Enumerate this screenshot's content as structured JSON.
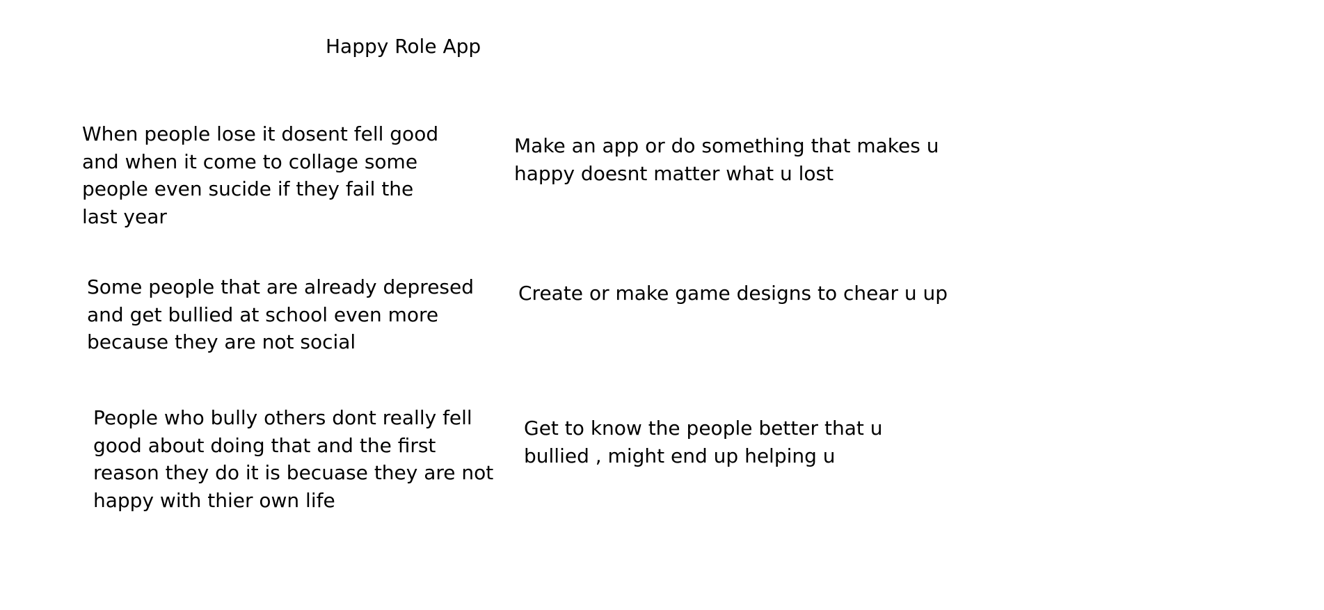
{
  "title": "Happy Role App",
  "rows": [
    {
      "problem": "When people lose it dosent fell good\nand when it come to collage some\npeople even sucide if they fail the\nlast year",
      "solution": "Make an app or do something that makes u\nhappy doesnt matter what u lost"
    },
    {
      "problem": "Some people that are already depresed\nand get bullied at school even more\nbecause they are not social",
      "solution": "Create or make game designs to chear u up"
    },
    {
      "problem": "People who bully others dont really fell\ngood about doing that and the first\nreason they do it is becuase they are not\nhappy with thier own life",
      "solution": "Get to know the people better that u\nbullied , might end up helping u"
    }
  ]
}
